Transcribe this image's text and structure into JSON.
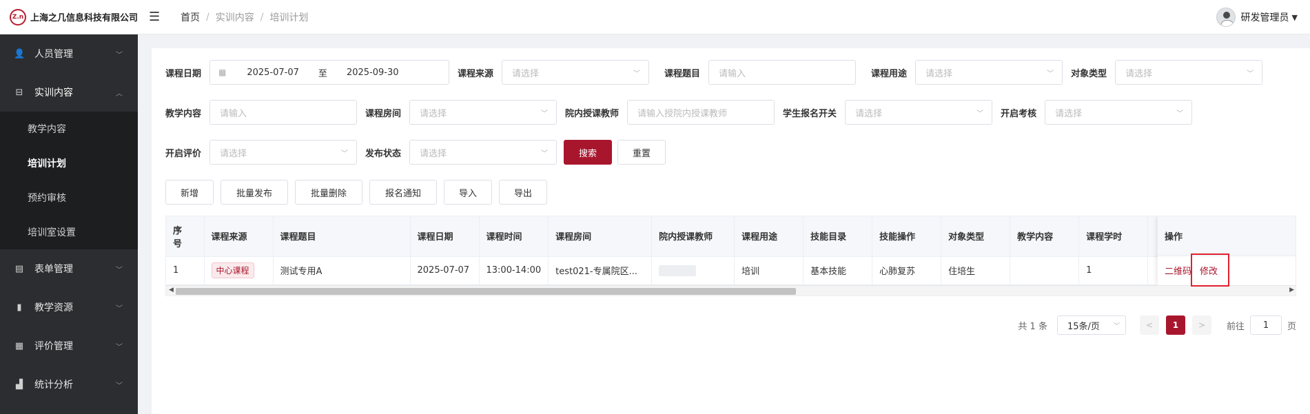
{
  "header": {
    "logo_mark": "Z.n",
    "company": "上海之几信息科技有限公司",
    "breadcrumb": [
      "首页",
      "实训内容",
      "培训计划"
    ],
    "user_name": "研发管理员"
  },
  "sidebar": {
    "items": [
      {
        "label": "人员管理",
        "icon": "user-icon"
      },
      {
        "label": "实训内容",
        "icon": "training-icon",
        "open": true
      },
      {
        "label": "表单管理",
        "icon": "form-icon"
      },
      {
        "label": "教学资源",
        "icon": "resource-icon"
      },
      {
        "label": "评价管理",
        "icon": "evaluation-icon"
      },
      {
        "label": "统计分析",
        "icon": "chart-icon"
      }
    ],
    "submenu": [
      "教学内容",
      "培训计划",
      "预约审核",
      "培训室设置"
    ],
    "active_sub": "培训计划"
  },
  "filters": {
    "course_date_label": "课程日期",
    "date_start": "2025-07-07",
    "date_to": "至",
    "date_end": "2025-09-30",
    "source_label": "课程来源",
    "source_placeholder": "请选择",
    "title_label": "课程题目",
    "title_placeholder": "请输入",
    "purpose_label": "课程用途",
    "purpose_placeholder": "请选择",
    "target_label": "对象类型",
    "target_placeholder": "请选择",
    "content_label": "教学内容",
    "content_placeholder": "请输入",
    "room_label": "课程房间",
    "room_placeholder": "请选择",
    "teacher_label": "院内授课教师",
    "teacher_placeholder": "请输入授院内授课教师",
    "signup_label": "学生报名开关",
    "signup_placeholder": "请选择",
    "exam_label": "开启考核",
    "exam_placeholder": "请选择",
    "eval_label": "开启评价",
    "eval_placeholder": "请选择",
    "publish_label": "发布状态",
    "publish_placeholder": "请选择",
    "search_btn": "搜索",
    "reset_btn": "重置"
  },
  "toolbar": {
    "add": "新增",
    "batch_publish": "批量发布",
    "batch_delete": "批量删除",
    "signup_notice": "报名通知",
    "import": "导入",
    "export": "导出"
  },
  "table": {
    "headers": [
      "序号",
      "课程来源",
      "课程题目",
      "课程日期",
      "课程时间",
      "课程房间",
      "院内授课教师",
      "课程用途",
      "技能目录",
      "技能操作",
      "对象类型",
      "教学内容",
      "课程学时"
    ],
    "op_header": "操作",
    "rows": [
      {
        "index": "1",
        "source": "中心课程",
        "title": "测试专用A",
        "date": "2025-07-07",
        "time": "13:00-14:00",
        "room": "test021-专属院区...",
        "teacher": "",
        "purpose": "培训",
        "skill_dir": "基本技能",
        "skill_op": "心肺复苏",
        "target": "住培生",
        "content": "",
        "hours": "1",
        "op_qrcode": "二维码",
        "op_edit": "修改"
      }
    ]
  },
  "pagination": {
    "total": "共 1 条",
    "page_size": "15条/页",
    "current": "1",
    "goto_label": "前往",
    "goto_value": "1",
    "page_unit": "页"
  },
  "colors": {
    "brand": "#a8162d",
    "sidebar_bg": "#2b2d30",
    "highlight": "#e0202e"
  }
}
